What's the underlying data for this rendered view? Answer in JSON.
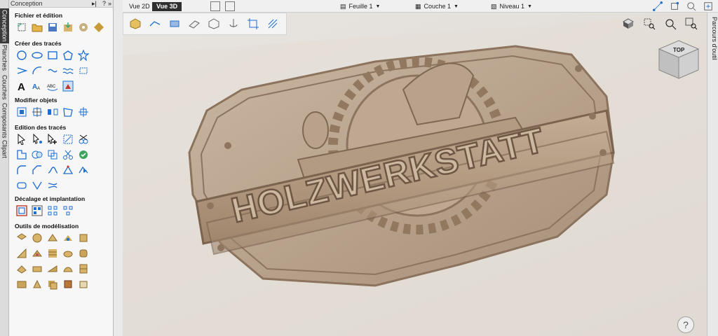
{
  "panel": {
    "title": "Conception",
    "pin_label": "▸|",
    "help_label": "?",
    "close_label": "»",
    "sections": [
      {
        "title": "Fichier et édition"
      },
      {
        "title": "Créer des tracés"
      },
      {
        "title": "Modifier objets"
      },
      {
        "title": "Edition des tracés"
      },
      {
        "title": "Décalage et implantation"
      },
      {
        "title": "Outils de modélisation"
      }
    ]
  },
  "vtabs": [
    "Conception",
    "Planches",
    "Couches",
    "Composants",
    "Clipart"
  ],
  "topbar": {
    "view2d": "Vue 2D",
    "view3d": "Vue 3D",
    "sheet": "Feuille 1",
    "layer": "Couche 1",
    "level": "Niveau 1"
  },
  "right_strip": {
    "label": "Parcours d'outil"
  },
  "model": {
    "text": "HOLZWERKSTATT"
  },
  "viewcube": {
    "label": "TOP"
  },
  "help": {
    "label": "?"
  },
  "colors": {
    "accent": "#1e6fd0",
    "panel_bg": "#f7f7f7",
    "wood": "#b39b82"
  }
}
